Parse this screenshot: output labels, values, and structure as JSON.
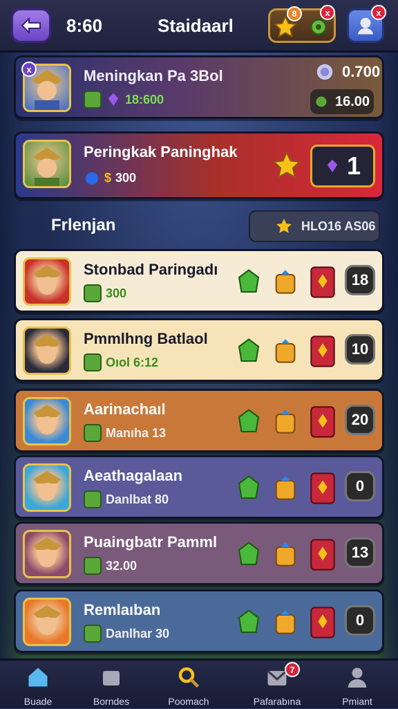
{
  "header": {
    "time": "8:60",
    "title": "Staidaarl",
    "resource_badge_num": "8",
    "resource_badge_x": "x",
    "profile_badge_x": "x"
  },
  "top_rows": [
    {
      "name": "Meningkan Pa 3Bol",
      "sub_value": "18:600",
      "right_top": "0.700",
      "right_pill": "16.00"
    },
    {
      "name": "Peringkak Paninghak",
      "sub_value": "300",
      "rank": "1"
    }
  ],
  "section": {
    "label": "Frlenjan",
    "filter_text": "HLO16 AS06"
  },
  "list_rows": [
    {
      "name": "Stonbad Paringadı",
      "sub_value": "300",
      "rank": "18",
      "bg": "#f6ecd6"
    },
    {
      "name": "Pmmlhng Batlaol",
      "sub_value": "Oıol 6:12",
      "rank": "10",
      "bg": "#f6e4b8"
    },
    {
      "name": "Aarinachaıl",
      "sub_value": "Manıha 13",
      "rank": "20",
      "bg": "#c8793a"
    },
    {
      "name": "Aeathagalaan",
      "sub_value": "Danlbat 80",
      "rank": "0",
      "bg": "#5a5a9a"
    },
    {
      "name": "Puaingbatr Pamml",
      "sub_value": "32.00",
      "rank": "13",
      "bg": "#7a5a7a"
    },
    {
      "name": "Remlaıban",
      "sub_value": "Danlhar 30",
      "rank": "0",
      "bg": "#4a6a9a"
    }
  ],
  "nav": [
    {
      "label": "Buade",
      "icon": "home-icon"
    },
    {
      "label": "Borndes",
      "icon": "cards-icon"
    },
    {
      "label": "Poomach",
      "icon": "search-icon"
    },
    {
      "label": "Pafarabına",
      "icon": "mail-icon",
      "badge": "7"
    },
    {
      "label": "Pmiant",
      "icon": "profile-icon"
    }
  ],
  "colors": {
    "accent": "#6a44c4",
    "gold": "#e8c24a",
    "green": "#5aa83a",
    "red": "#d9233a"
  }
}
